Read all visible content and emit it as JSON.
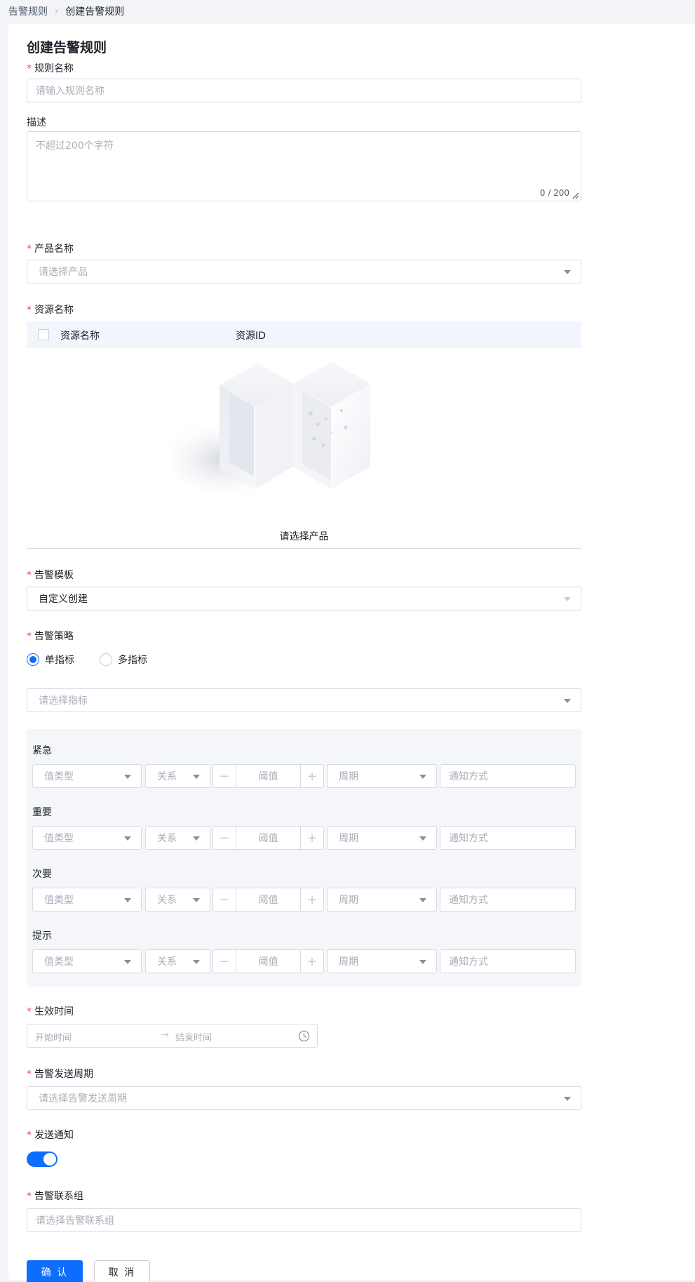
{
  "breadcrumb": {
    "parent": "告警规则",
    "current": "创建告警规则"
  },
  "page_title": "创建告警规则",
  "rule_name": {
    "label": "规则名称",
    "placeholder": "请输入规则名称"
  },
  "description": {
    "label": "描述",
    "placeholder": "不超过200个字符",
    "counter": "0 / 200"
  },
  "product": {
    "label": "产品名称",
    "placeholder": "请选择产品"
  },
  "resource": {
    "label": "资源名称",
    "columns": [
      "资源名称",
      "资源ID"
    ],
    "empty_text": "请选择产品"
  },
  "template": {
    "label": "告警模板",
    "value": "自定义创建"
  },
  "strategy": {
    "label": "告警策略",
    "options": [
      "单指标",
      "多指标"
    ],
    "selected": "单指标",
    "metric_placeholder": "请选择指标"
  },
  "levels": [
    {
      "name": "紧急"
    },
    {
      "name": "重要"
    },
    {
      "name": "次要"
    },
    {
      "name": "提示"
    }
  ],
  "level_fields": {
    "value_type": "值类型",
    "relation": "关系",
    "threshold": "阈值",
    "period": "周期",
    "notify": "通知方式",
    "minus": "−",
    "plus": "+"
  },
  "effective_time": {
    "label": "生效时间",
    "start": "开始时间",
    "arrow": "→",
    "end": "结束时间"
  },
  "send_period": {
    "label": "告警发送周期",
    "placeholder": "请选择告警发送周期"
  },
  "send_notify": {
    "label": "发送通知",
    "enabled": true
  },
  "contact_group": {
    "label": "告警联系组",
    "placeholder": "请选择告警联系组"
  },
  "actions": {
    "confirm": "确 认",
    "cancel": "取 消"
  },
  "colors": {
    "primary": "#0d6efd",
    "required": "#f53f3f",
    "panel": "#f4f6f9",
    "table_head": "#f2f5fc"
  },
  "required_mark": "*"
}
